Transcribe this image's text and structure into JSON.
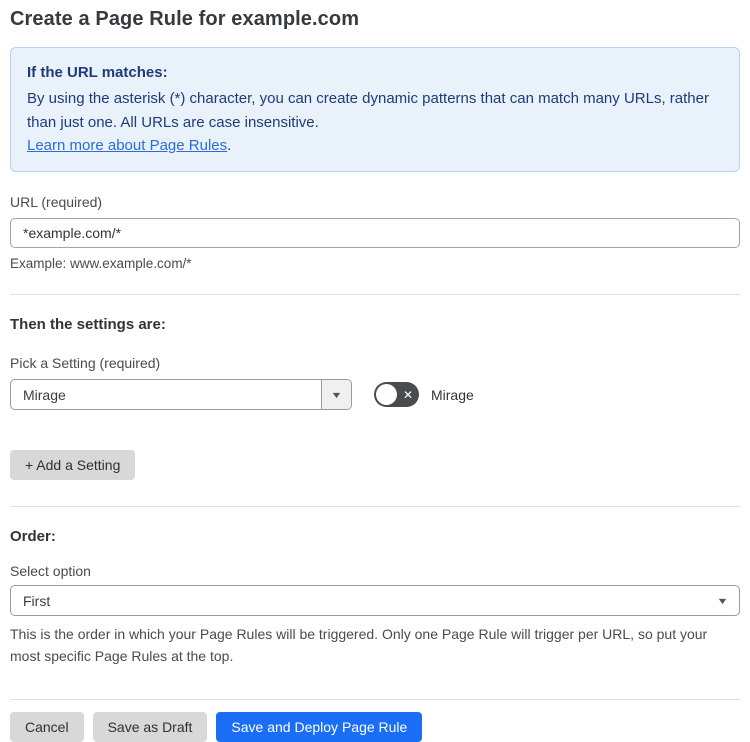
{
  "page": {
    "title": "Create a Page Rule for example.com"
  },
  "info_box": {
    "heading": "If the URL matches:",
    "body": "By using the asterisk (*) character, you can create dynamic patterns that can match many URLs, rather than just one. All URLs are case insensitive.",
    "link_label": "Learn more about Page Rules",
    "link_suffix": "."
  },
  "url_field": {
    "label": "URL (required)",
    "value": "*example.com/*",
    "helper": "Example: www.example.com/*"
  },
  "settings_section": {
    "heading": "Then the settings are:",
    "picker_label": "Pick a Setting (required)",
    "selected_setting": "Mirage",
    "toggle_label": "Mirage",
    "toggle_state": "off",
    "add_setting_label": "+ Add a Setting"
  },
  "order_section": {
    "heading": "Order:",
    "select_label": "Select option",
    "selected_option": "First",
    "helper": "This is the order in which your Page Rules will be triggered. Only one Page Rule will trigger per URL, so put your most specific Page Rules at the top."
  },
  "footer": {
    "cancel_label": "Cancel",
    "save_draft_label": "Save as Draft",
    "save_deploy_label": "Save and Deploy Page Rule"
  },
  "icons": {
    "toggle_off_x": "✕",
    "dropdown_arrow": "▼"
  },
  "colors": {
    "accent_blue": "#1a6ef5",
    "info_background": "#e9f1fb",
    "info_border": "#b9d3ee",
    "info_text": "#1e3c78",
    "link_blue": "#2c6cd6",
    "toggle_off_background": "#4a4b4f",
    "gray_button": "#d8d8d8"
  }
}
